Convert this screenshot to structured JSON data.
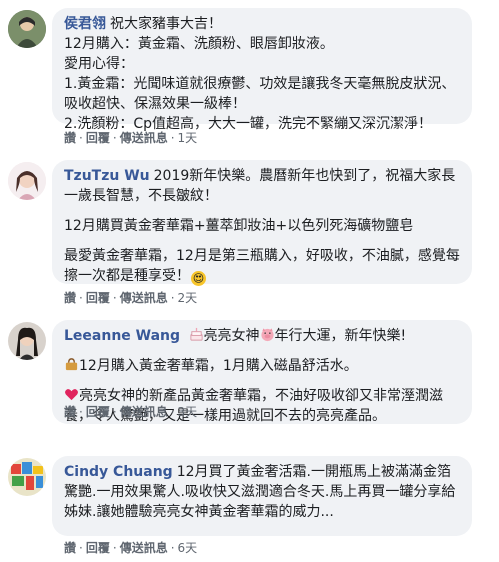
{
  "actions": {
    "like": "讚",
    "reply": "回覆",
    "send_message": "傳送訊息"
  },
  "comments": [
    {
      "name": "侯君翎",
      "lines": [
        "祝大家豬事大吉！",
        "12月購入：黃金霜、洗顏粉、眼唇卸妝液。",
        "愛用心得：",
        "1.黃金霜：光聞味道就很療鬱、功效是讓我冬天毫無脫皮狀況、吸收超快、保濕效果一級棒！",
        "2.洗顏粉：Cp值超高，大大一罐，洗完不緊繃又深沉潔淨！"
      ],
      "time": "1天"
    },
    {
      "name": "TzuTzu Wu",
      "p1": "2019新年快樂。農曆新年也快到了，祝福大家長一歲長智慧，不長皺紋！",
      "p2": "12月購買黃金奢華霜+薑萃卸妝油+以色列死海礦物鹽皂",
      "p3": "最愛黃金奢華霜，12月是第三瓶購入，好吸收，不油膩，感覺每擦一次都是種享受！",
      "emoji_heart_eyes": "😍",
      "time": "2天"
    },
    {
      "name": "Leeanne Wang",
      "p1a": "亮亮女神",
      "p1b": "年行大運，新年快樂!",
      "p2": "12月購入黃金奢華霜，1月購入磁晶舒活水。",
      "p3": "亮亮女神的新產品黃金奢華霜，不油好吸收卻又非常溼潤滋養，令人驚艷，又是一樣用過就回不去的亮亮產品。",
      "time": "3天"
    },
    {
      "name": "Cindy Chuang",
      "text": "12月買了黃金奢活霜.一開瓶馬上被滿滿金箔驚艷.一用效果驚人.吸收快又滋潤適合冬天.馬上再買一罐分享給姊妹.讓她體驗亮亮女神黃金奢華霜的威力...",
      "time": "6天"
    }
  ],
  "colors": {
    "name": "#385898",
    "bubble": "#f0f2f5",
    "meta": "#606770"
  }
}
